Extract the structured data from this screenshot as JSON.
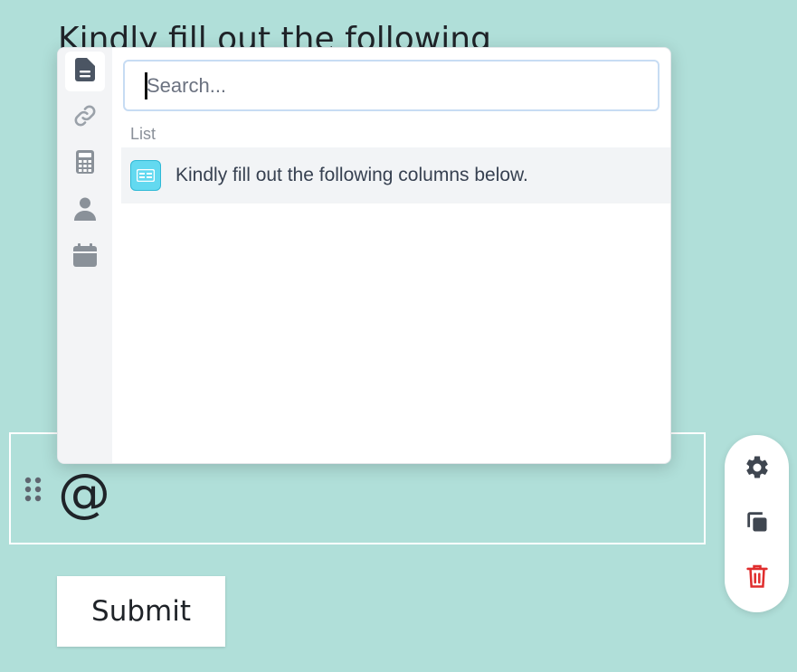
{
  "form": {
    "heading": "Kindly fill out the following",
    "field_text": "@",
    "submit_label": "Submit"
  },
  "tools": [
    {
      "name": "settings",
      "icon": "gear-icon",
      "color": "#3f4650"
    },
    {
      "name": "duplicate",
      "icon": "copy-icon",
      "color": "#3f4650"
    },
    {
      "name": "delete",
      "icon": "trash-icon",
      "color": "#e02d2d"
    }
  ],
  "popover": {
    "rail": [
      {
        "icon": "document-icon",
        "active": true
      },
      {
        "icon": "link-icon",
        "active": false
      },
      {
        "icon": "calculator-icon",
        "active": false
      },
      {
        "icon": "person-icon",
        "active": false
      },
      {
        "icon": "calendar-icon",
        "active": false
      }
    ],
    "search": {
      "placeholder": "Search...",
      "value": ""
    },
    "section_label": "List",
    "results": [
      {
        "label": "Kindly fill out the following columns below.",
        "icon": "list-field-icon"
      }
    ]
  },
  "colors": {
    "page_background": "#b0dfd9",
    "result_icon_bg": "#63d9f0",
    "delete": "#e02d2d"
  }
}
